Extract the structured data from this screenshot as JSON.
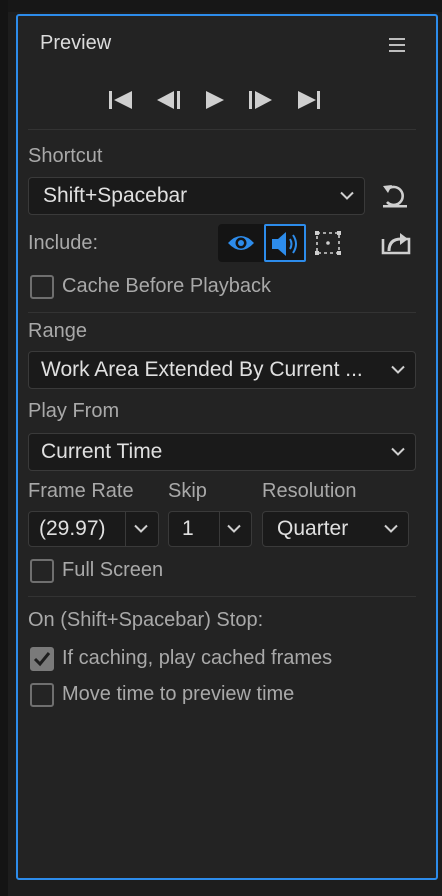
{
  "panel": {
    "title": "Preview",
    "menu_icon": "hamburger-icon",
    "accent_color": "#2d8ceb"
  },
  "transport": {
    "icons": [
      "first-frame-icon",
      "previous-frame-icon",
      "play-icon",
      "next-frame-icon",
      "last-frame-icon"
    ]
  },
  "shortcut": {
    "label": "Shortcut",
    "value": "Shift+Spacebar",
    "reset_icon": "reset-icon"
  },
  "include": {
    "label": "Include:",
    "icons": [
      "eye-icon",
      "audio-icon",
      "overlay-icon"
    ],
    "export_icon": "export-icon",
    "audio_active": true
  },
  "cache_before_playback": {
    "label": "Cache Before Playback",
    "checked": false
  },
  "range": {
    "label": "Range",
    "value": "Work Area Extended By Current ..."
  },
  "play_from": {
    "label": "Play From",
    "value": "Current Time"
  },
  "frame_rate": {
    "label": "Frame Rate",
    "value": "(29.97)"
  },
  "skip": {
    "label": "Skip",
    "value": "1"
  },
  "resolution": {
    "label": "Resolution",
    "value": "Quarter"
  },
  "full_screen": {
    "label": "Full Screen",
    "checked": false
  },
  "on_stop": {
    "label": "On (Shift+Spacebar) Stop:",
    "if_caching": {
      "label": "If caching, play cached frames",
      "checked": true
    },
    "move_time": {
      "label": "Move time to preview time",
      "checked": false
    }
  }
}
